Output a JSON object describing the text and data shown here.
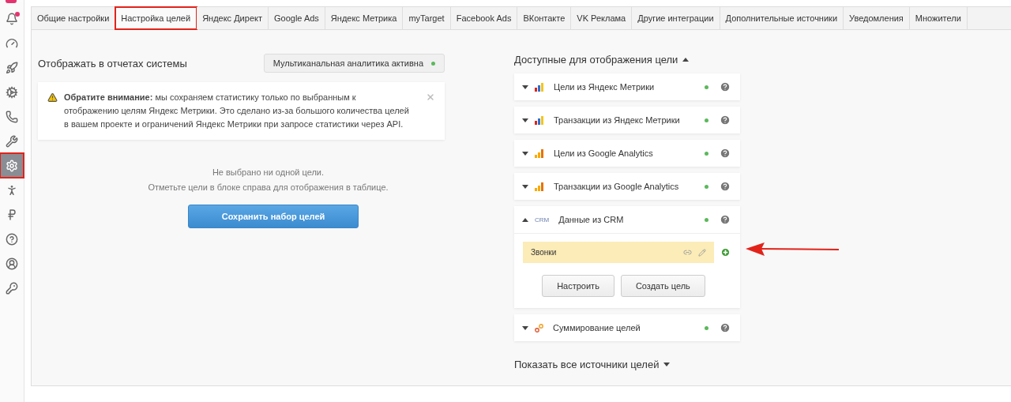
{
  "sidebar": {
    "items": [
      {
        "selected": false,
        "highlighted": false,
        "badge": true
      },
      {
        "selected": false,
        "highlighted": false,
        "badge": false
      },
      {
        "selected": false,
        "highlighted": false,
        "badge": false
      },
      {
        "selected": false,
        "highlighted": false,
        "badge": false
      },
      {
        "selected": false,
        "highlighted": false,
        "badge": false
      },
      {
        "selected": false,
        "highlighted": false,
        "badge": false
      },
      {
        "selected": true,
        "highlighted": true,
        "badge": false
      },
      {
        "selected": false,
        "highlighted": false,
        "badge": false
      },
      {
        "selected": false,
        "highlighted": false,
        "badge": false
      },
      {
        "selected": false,
        "highlighted": false,
        "badge": false
      },
      {
        "selected": false,
        "highlighted": false,
        "badge": false
      },
      {
        "selected": false,
        "highlighted": false,
        "badge": false
      }
    ]
  },
  "tabs": [
    {
      "label": "Общие настройки",
      "selected": false,
      "highlighted": false
    },
    {
      "label": "Настройка целей",
      "selected": true,
      "highlighted": true
    },
    {
      "label": "Яндекс Директ",
      "selected": false,
      "highlighted": false
    },
    {
      "label": "Google Ads",
      "selected": false,
      "highlighted": false
    },
    {
      "label": "Яндекс Метрика",
      "selected": false,
      "highlighted": false
    },
    {
      "label": "myTarget",
      "selected": false,
      "highlighted": false
    },
    {
      "label": "Facebook Ads",
      "selected": false,
      "highlighted": false
    },
    {
      "label": "ВКонтакте",
      "selected": false,
      "highlighted": false
    },
    {
      "label": "VK Реклама",
      "selected": false,
      "highlighted": false
    },
    {
      "label": "Другие интеграции",
      "selected": false,
      "highlighted": false
    },
    {
      "label": "Дополнительные источники",
      "selected": false,
      "highlighted": false
    },
    {
      "label": "Уведомления",
      "selected": false,
      "highlighted": false
    },
    {
      "label": "Множители",
      "selected": false,
      "highlighted": false
    }
  ],
  "left": {
    "title": "Отображать в отчетах системы",
    "multichannel": {
      "label": "Мультиканальная аналитика активна",
      "on": true
    },
    "notice": {
      "text": "**Обратите внимание:** мы сохраняем статистику только по выбранным к отображению целям Яндекс Метрики. Это сделано из-за большого количества целей в вашем проекте и ограничений Яндекс Метрики при запросе статистики через API."
    },
    "empty": [
      "Не выбрано ни одной цели.",
      "Отметьте цели в блоке справа для отображения в таблице."
    ],
    "save_button": "Сохранить набор целей"
  },
  "right": {
    "title": "Доступные для отображения цели",
    "title_expanded": true,
    "sources": [
      {
        "kind": "yandex",
        "name": "Цели из Яндекс Метрики",
        "expanded": false,
        "active": true
      },
      {
        "kind": "yandex",
        "name": "Транзакции из Яндекс Метрики",
        "expanded": false,
        "active": true
      },
      {
        "kind": "ga",
        "name": "Цели из Google Analytics",
        "expanded": false,
        "active": true
      },
      {
        "kind": "ga",
        "name": "Транзакции из Google Analytics",
        "expanded": false,
        "active": true
      },
      {
        "kind": "crm",
        "icon_text": "CRM",
        "name": "Данные из CRM",
        "expanded": true,
        "active": true,
        "goals": [
          {
            "name": "Звонки",
            "pointed": true
          }
        ],
        "buttons": [
          "Настроить",
          "Создать цель"
        ]
      },
      {
        "kind": "sum",
        "name": "Суммирование целей",
        "expanded": false,
        "active": true
      }
    ],
    "show_all": "Показать все источники целей",
    "show_all_expanded": false
  }
}
